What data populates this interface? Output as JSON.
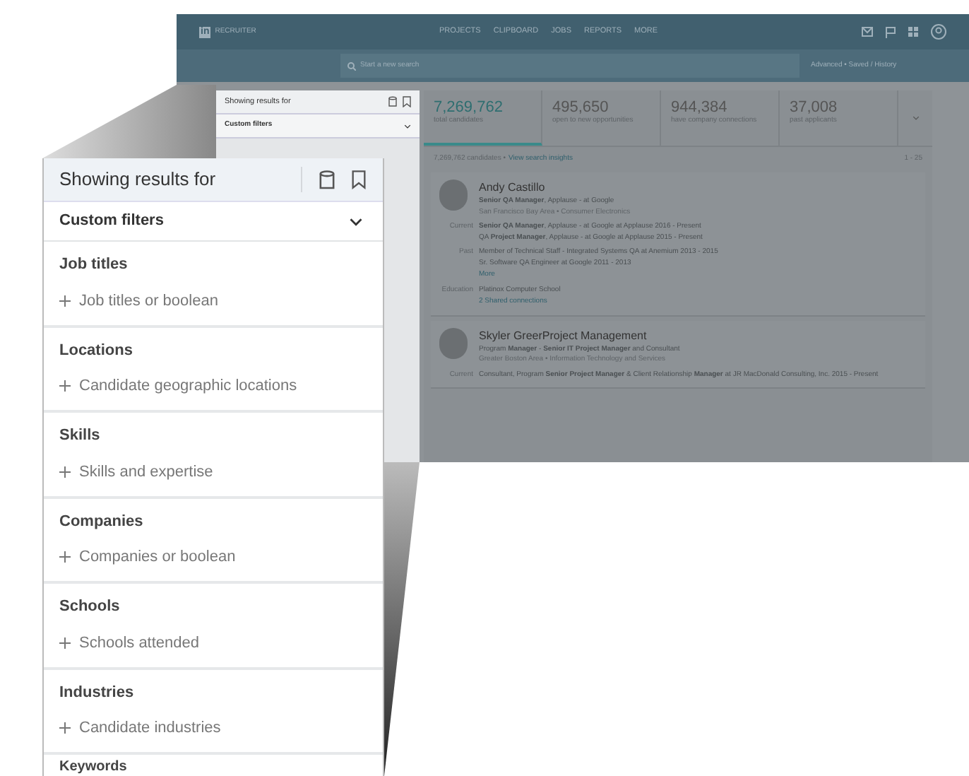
{
  "top_nav": {
    "logo": "in",
    "brand": "RECRUITER",
    "menu": [
      "PROJECTS",
      "CLIPBOARD",
      "JOBS",
      "REPORTS",
      "MORE"
    ]
  },
  "search": {
    "placeholder": "Start a new search",
    "links": "Advanced • Saved / History"
  },
  "filter_panel": {
    "title": "Showing results for",
    "custom_filters": "Custom filters"
  },
  "stats": [
    {
      "value": "7,269,762",
      "label": "total candidates",
      "selected": true
    },
    {
      "value": "495,650",
      "label": "open to new opportunities",
      "selected": false
    },
    {
      "value": "944,384",
      "label": "have company connections",
      "selected": false
    },
    {
      "value": "37,008",
      "label": "past applicants",
      "selected": false
    }
  ],
  "results_bar": {
    "count": "7,269,762 candidates •",
    "link": "View search insights",
    "pagination": "1 - 25"
  },
  "candidates": [
    {
      "name": "Andy Castillo",
      "headline": "**Senior QA Manager**, Applause - at Google",
      "location": "San Francisco Bay Area • Consumer Electronics",
      "details": [
        {
          "label": "Current",
          "lines": [
            "**Senior QA Manager**, Applause - at Google at Applause 2016 - Present",
            "QA **Project Manager**, Applause - at Google at Applause 2015 - Present"
          ]
        },
        {
          "label": "Past",
          "lines": [
            "Member of Technical Staff - Integrated Systems QA at Anemium 2013 - 2015",
            "Sr. Software QA Engineer at Google 2011 - 2013"
          ]
        }
      ],
      "more": "More",
      "education_label": "Education",
      "education": "Platinox Computer School",
      "connections": "2 Shared connections"
    },
    {
      "name": "Skyler GreerProject Management",
      "headline": "Program **Manager** - **Senior IT Project Manager** and Consultant",
      "location": "Greater Boston Area • Information Technology and Services",
      "details": [
        {
          "label": "Current",
          "lines": [
            "Consultant, Program **Senior Project Manager** & Client Relationship **Manager** at JR MacDonald Consulting, Inc. 2015 - Present"
          ]
        }
      ]
    }
  ],
  "zoomed_panel": {
    "title": "Showing results for",
    "custom_filters": "Custom filters",
    "sections": [
      {
        "title": "Job titles",
        "placeholder": "Job titles or boolean"
      },
      {
        "title": "Locations",
        "placeholder": "Candidate geographic locations"
      },
      {
        "title": "Skills",
        "placeholder": "Skills and expertise"
      },
      {
        "title": "Companies",
        "placeholder": "Companies or boolean"
      },
      {
        "title": "Schools",
        "placeholder": "Schools attended"
      },
      {
        "title": "Industries",
        "placeholder": "Candidate industries"
      }
    ],
    "cut_section": "Keywords"
  }
}
